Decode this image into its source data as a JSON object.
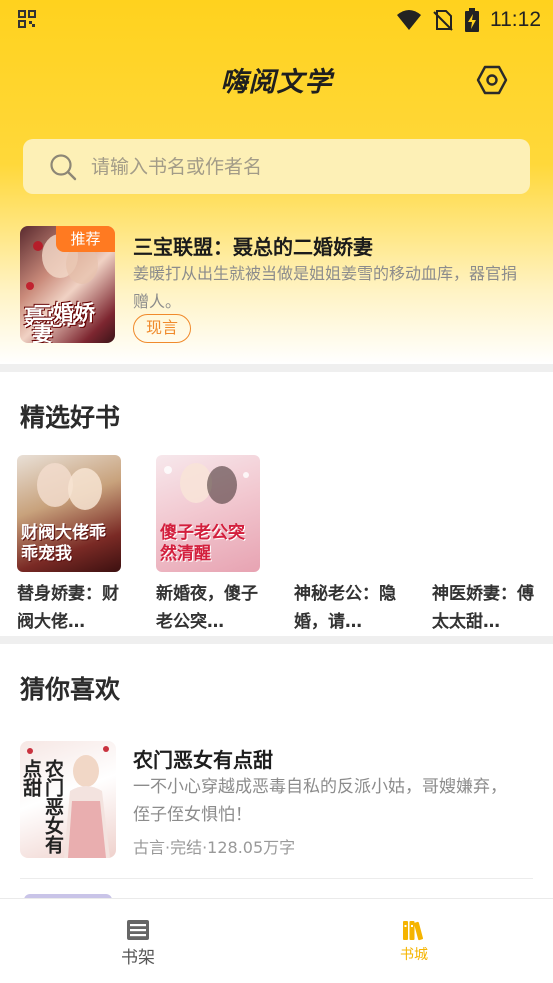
{
  "status_bar": {
    "time": "11:12"
  },
  "app": {
    "title": "嗨阅文学"
  },
  "search": {
    "placeholder": "请输入书名或作者名"
  },
  "featured": {
    "badge": "推荐",
    "title": "三宝联盟：聂总的二婚娇妻",
    "description": "姜暖打从出生就被当做是姐姐姜雪的移动血库，器官捐赠人。",
    "tag": "现言",
    "cover_text_1": "聂总的",
    "cover_text_2": "二婚娇妻"
  },
  "section_picks": {
    "title": "精选好书",
    "books": [
      {
        "title": "替身娇妻：财阀大佬…",
        "cover_text": "财阀大佬乖乖宠我"
      },
      {
        "title": "新婚夜，傻子老公突…",
        "cover_text": "傻子老公突然清醒"
      },
      {
        "title": "神秘老公：隐婚，请…"
      },
      {
        "title": "神医娇妻：傅太太甜…"
      }
    ]
  },
  "section_guess": {
    "title": "猜你喜欢",
    "items": [
      {
        "title": "农门恶女有点甜",
        "description": "一不小心穿越成恶毒自私的反派小姑，哥嫂嫌弃，侄子侄女惧怕！",
        "meta": "古言·完结·128.05万字",
        "cover_text": "农门恶女有点甜"
      }
    ]
  },
  "tabbar": {
    "tabs": [
      {
        "label": "书架",
        "active": false,
        "icon": "bookshelf-icon"
      },
      {
        "label": "书城",
        "active": true,
        "icon": "bookstore-icon"
      }
    ]
  },
  "colors": {
    "brand_yellow": "#ffd21e",
    "accent_orange": "#f08a2c",
    "tab_active": "#f5b400"
  }
}
